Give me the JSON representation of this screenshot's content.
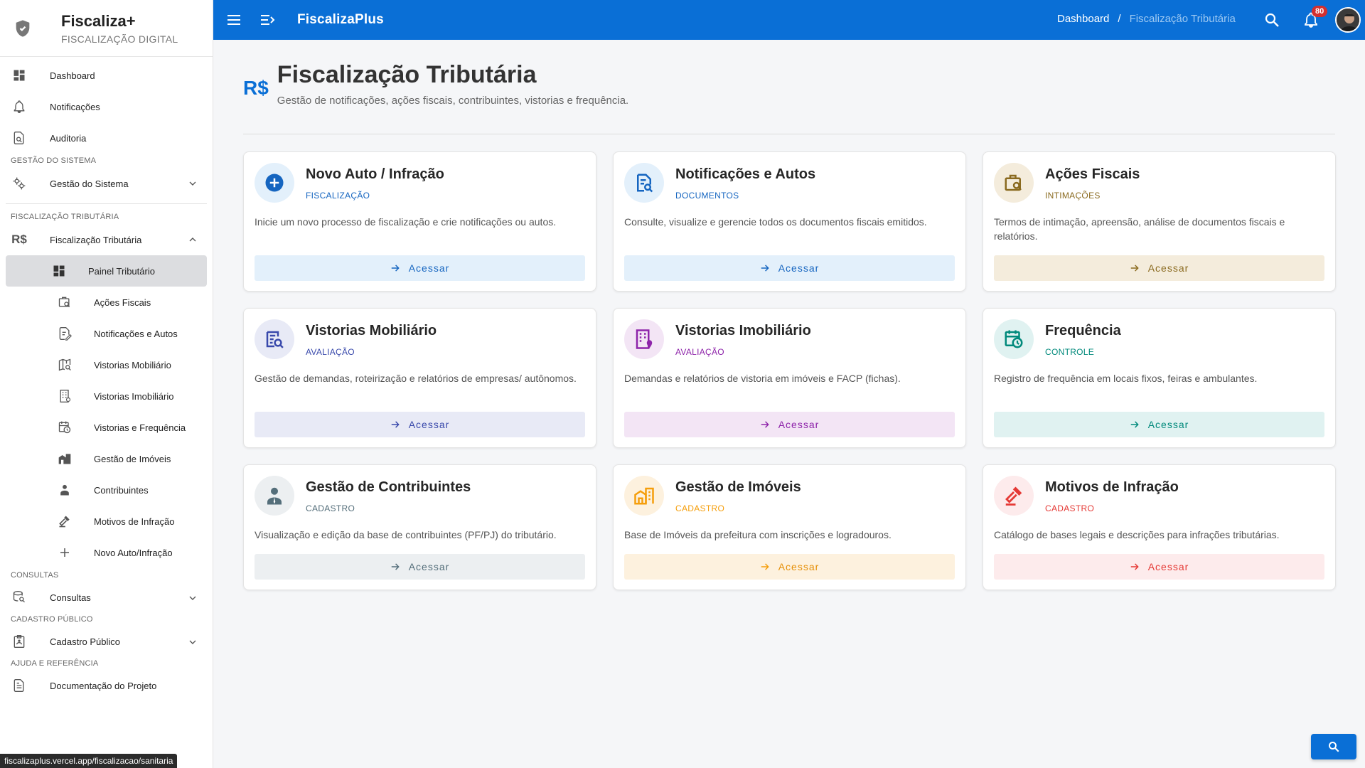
{
  "brand": {
    "name": "Fiscaliza+",
    "subtitle": "FISCALIZAÇÃO DIGITAL"
  },
  "sidebar": {
    "top_items": [
      {
        "label": "Dashboard",
        "icon": "dashboard-icon"
      },
      {
        "label": "Notificações",
        "icon": "bell-icon"
      },
      {
        "label": "Auditoria",
        "icon": "document-search-icon"
      }
    ],
    "sections": {
      "gestao": "GESTÃO DO SISTEMA",
      "fiscalizacao": "FISCALIZAÇÃO TRIBUTÁRIA",
      "consultas": "CONSULTAS",
      "cadastro": "CADASTRO PÚBLICO",
      "ajuda": "AJUDA E REFERÊNCIA"
    },
    "gestao_item": "Gestão do Sistema",
    "fiscalizacao_item": "Fiscalização Tributária",
    "sub_items": [
      {
        "label": "Painel Tributário",
        "icon": "dashboard-icon"
      },
      {
        "label": "Ações Fiscais",
        "icon": "briefcase-search-icon"
      },
      {
        "label": "Notificações e Autos",
        "icon": "document-edit-icon"
      },
      {
        "label": "Vistorias Mobiliário",
        "icon": "map-search-icon"
      },
      {
        "label": "Vistorias Imobiliário",
        "icon": "building-icon"
      },
      {
        "label": "Vistorias e Frequência",
        "icon": "calendar-clock-icon"
      },
      {
        "label": "Gestão de Imóveis",
        "icon": "buildings-icon"
      },
      {
        "label": "Contribuintes",
        "icon": "people-icon"
      },
      {
        "label": "Motivos de Infração",
        "icon": "gavel-icon"
      },
      {
        "label": "Novo Auto/Infração",
        "icon": "plus-icon"
      }
    ],
    "consultas_item": "Consultas",
    "cadastro_item": "Cadastro Público",
    "ajuda_item": "Documentação do Projeto"
  },
  "statusbar": {
    "url": "fiscalizaplus.vercel.app/fiscalizacao/sanitaria"
  },
  "topbar": {
    "app_title": "FiscalizaPlus",
    "breadcrumb": {
      "root": "Dashboard",
      "sep": "/",
      "current": "Fiscalização Tributária"
    },
    "notification_count": "80"
  },
  "page": {
    "icon_text": "R$",
    "title": "Fiscalização Tributária",
    "description": "Gestão de notificações, ações fiscais, contribuintes, vistorias e frequência."
  },
  "cards": [
    {
      "title": "Novo Auto / Infração",
      "tag": "FISCALIZAÇÃO",
      "text": "Inicie um novo processo de fiscalização e crie notificações ou autos.",
      "button": "Acessar",
      "accent": "#1565c0",
      "bg": "#e3f0fb",
      "circle_bg": "#e3f0fb",
      "icon": "plus-circle-icon"
    },
    {
      "title": "Notificações e Autos",
      "tag": "DOCUMENTOS",
      "text": "Consulte, visualize e gerencie todos os documentos fiscais emitidos.",
      "button": "Acessar",
      "accent": "#1565c0",
      "bg": "#e3f0fb",
      "circle_bg": "#e3f0fb",
      "icon": "document-search-icon"
    },
    {
      "title": "Ações Fiscais",
      "tag": "INTIMAÇÕES",
      "text": "Termos de intimação, apreensão, análise de documentos fiscais e relatórios.",
      "button": "Acessar",
      "accent": "#8a6a1f",
      "bg": "#f4ecdc",
      "circle_bg": "#f4ecdc",
      "icon": "briefcase-search-icon"
    },
    {
      "title": "Vistorias Mobiliário",
      "tag": "AVALIAÇÃO",
      "text": "Gestão de demandas, roteirização e relatórios de empresas/ autônomos.",
      "button": "Acessar",
      "accent": "#3949ab",
      "bg": "#e8eaf6",
      "circle_bg": "#e8eaf6",
      "icon": "list-search-icon"
    },
    {
      "title": "Vistorias Imobiliário",
      "tag": "AVALIAÇÃO",
      "text": "Demandas e relatórios de vistoria em imóveis e FACP (fichas).",
      "button": "Acessar",
      "accent": "#8e24aa",
      "bg": "#f3e5f5",
      "circle_bg": "#f3e5f5",
      "icon": "building-pin-icon"
    },
    {
      "title": "Frequência",
      "tag": "CONTROLE",
      "text": "Registro de frequência em locais fixos, feiras e ambulantes.",
      "button": "Acessar",
      "accent": "#00897b",
      "bg": "#e0f2f1",
      "circle_bg": "#e0f2f1",
      "icon": "calendar-clock-icon"
    },
    {
      "title": "Gestão de Contribuintes",
      "tag": "CADASTRO",
      "text": "Visualização e edição da base de contribuintes (PF/PJ) do tributário.",
      "button": "Acessar",
      "accent": "#546e7a",
      "bg": "#eceff1",
      "circle_bg": "#eceff1",
      "icon": "person-tie-icon"
    },
    {
      "title": "Gestão de Imóveis",
      "tag": "CADASTRO",
      "text": "Base de Imóveis da prefeitura com inscrições e logradouros.",
      "button": "Acessar",
      "accent": "#f59e0b",
      "bg": "#fdf1de",
      "circle_bg": "#fdf1de",
      "icon": "buildings-icon"
    },
    {
      "title": "Motivos de Infração",
      "tag": "CADASTRO",
      "text": "Catálogo de bases legais e descrições para infrações tributárias.",
      "button": "Acessar",
      "accent": "#e53935",
      "bg": "#fdebec",
      "circle_bg": "#fdebec",
      "icon": "gavel-icon"
    }
  ]
}
